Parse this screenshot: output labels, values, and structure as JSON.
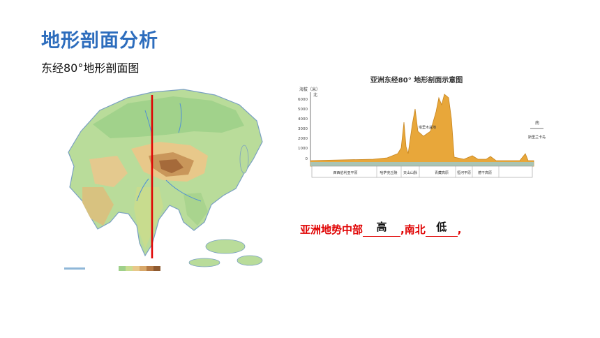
{
  "title": "地形剖面分析",
  "subtitle": "东经80°地形剖面图",
  "profile": {
    "north_label": "北",
    "south_label": "南",
    "chart_title": "亚洲东经80° 地形剖面示意图",
    "y_axis_title": "海拔（米）",
    "north_tag": "北",
    "south_tag": "南",
    "y_ticks": [
      "6000",
      "5000",
      "4000",
      "3000",
      "2000",
      "1000",
      "0"
    ],
    "basin_label": "塔里木盆地",
    "regions": [
      "西西伯利亚平原",
      "哈萨克丘陵",
      "天山山脉",
      "青藏高原",
      "恒河平原",
      "德干高原"
    ],
    "right_end_label": "斯里兰卡岛"
  },
  "question": {
    "part1": "亚洲地势中部",
    "answer1": "高",
    "part2": ",南北",
    "answer2": "低",
    "end": ","
  },
  "colors": {
    "title": "#2d6dbd",
    "accent": "#e00000",
    "terrain": "#e8a73a",
    "water": "#8fd0e8"
  }
}
